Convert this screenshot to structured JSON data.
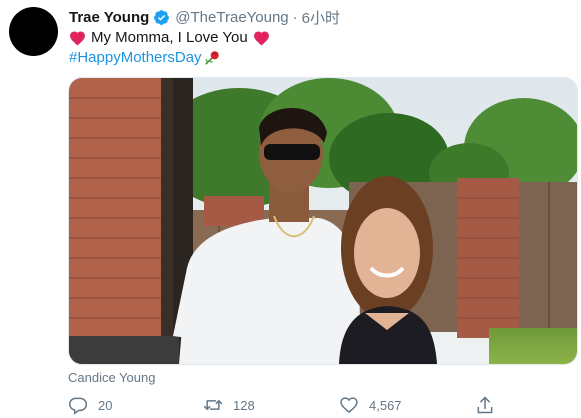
{
  "tweet": {
    "display_name": "Trae Young",
    "handle": "@TheTraeYoung",
    "separator": "·",
    "time": "6小时",
    "message": "My Momma, I Love You",
    "hashtag": "#HappyMothersDay",
    "photo_caption": "Candice Young",
    "reply_count": "20",
    "retweet_count": "128",
    "like_count": "4,567"
  },
  "colors": {
    "link": "#1b95e0",
    "secondary_text": "#657786",
    "heart": "#e0245e",
    "verified": "#1da1f2"
  },
  "icons": [
    "verified-badge-icon",
    "red-heart-icon",
    "rose-icon",
    "reply-icon",
    "retweet-icon",
    "like-icon",
    "share-icon"
  ]
}
